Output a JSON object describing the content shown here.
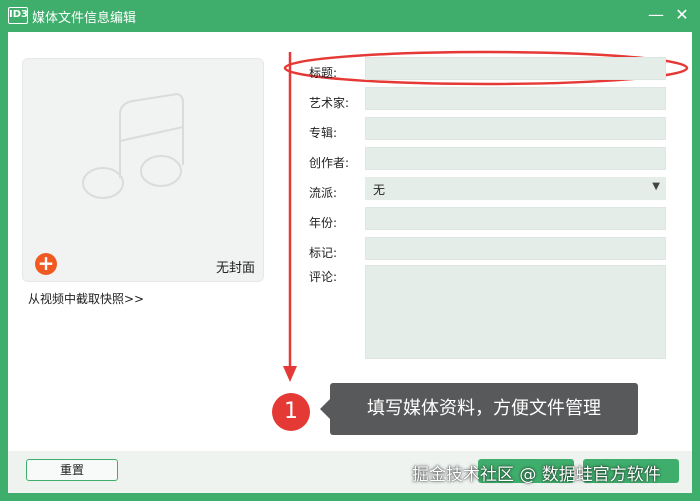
{
  "window": {
    "app_icon_text": "ID3",
    "title": "媒体文件信息编辑",
    "minimize_symbol": "—",
    "close_symbol": "✕"
  },
  "cover": {
    "placeholder_icon": "music-note-icon",
    "add_symbol": "+",
    "no_cover_label": "无封面",
    "capture_link": "从视频中截取快照>>"
  },
  "fields": {
    "title_label": "标题:",
    "artist_label": "艺术家:",
    "album_label": "专辑:",
    "composer_label": "创作者:",
    "genre_label": "流派:",
    "genre_value": "无",
    "year_label": "年份:",
    "tags_label": "标记:",
    "comment_label": "评论:"
  },
  "annotation": {
    "step_number": "1",
    "tip": "填写媒体资料，方便文件管理",
    "accent_color": "#e53935"
  },
  "footer": {
    "reset_label": "重置"
  },
  "watermark": "掘金技术社区 @ 数据蛙官方软件",
  "colors": {
    "brand_green": "#3fae6c",
    "input_bg": "#e4ede8"
  }
}
